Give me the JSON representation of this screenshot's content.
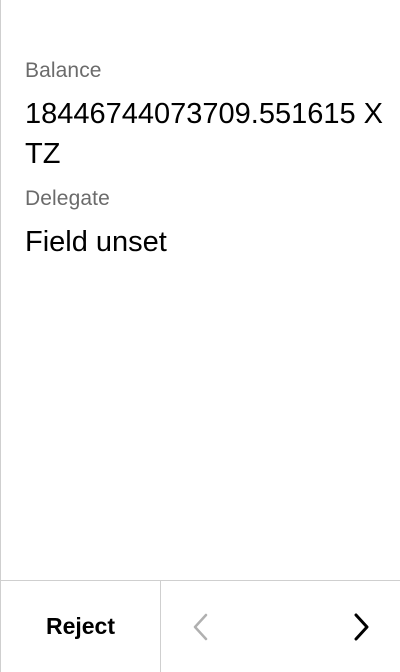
{
  "fields": [
    {
      "label": "Balance",
      "value": "18446744073709.551615 XTZ"
    },
    {
      "label": "Delegate",
      "value": "Field unset"
    }
  ],
  "footer": {
    "reject_label": "Reject"
  },
  "colors": {
    "text": "#000000",
    "label": "#6b6b6b",
    "divider": "#cfcfcf",
    "disabled_icon": "#b0b0b0"
  },
  "icons": {
    "prev": "chevron-left-icon",
    "next": "chevron-right-icon"
  }
}
